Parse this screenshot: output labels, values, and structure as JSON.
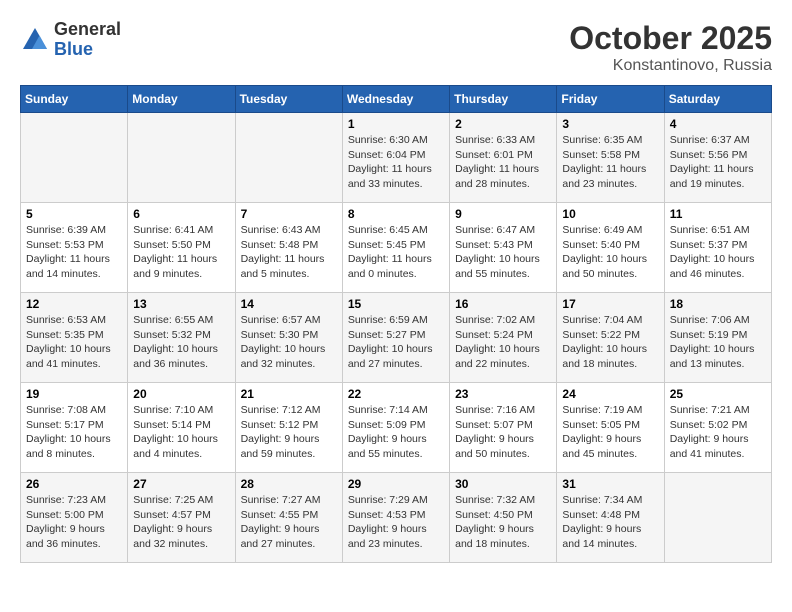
{
  "logo": {
    "general": "General",
    "blue": "Blue"
  },
  "header": {
    "month": "October 2025",
    "location": "Konstantinovo, Russia"
  },
  "days_header": [
    "Sunday",
    "Monday",
    "Tuesday",
    "Wednesday",
    "Thursday",
    "Friday",
    "Saturday"
  ],
  "weeks": [
    [
      {
        "day": "",
        "info": ""
      },
      {
        "day": "",
        "info": ""
      },
      {
        "day": "",
        "info": ""
      },
      {
        "day": "1",
        "info": "Sunrise: 6:30 AM\nSunset: 6:04 PM\nDaylight: 11 hours\nand 33 minutes."
      },
      {
        "day": "2",
        "info": "Sunrise: 6:33 AM\nSunset: 6:01 PM\nDaylight: 11 hours\nand 28 minutes."
      },
      {
        "day": "3",
        "info": "Sunrise: 6:35 AM\nSunset: 5:58 PM\nDaylight: 11 hours\nand 23 minutes."
      },
      {
        "day": "4",
        "info": "Sunrise: 6:37 AM\nSunset: 5:56 PM\nDaylight: 11 hours\nand 19 minutes."
      }
    ],
    [
      {
        "day": "5",
        "info": "Sunrise: 6:39 AM\nSunset: 5:53 PM\nDaylight: 11 hours\nand 14 minutes."
      },
      {
        "day": "6",
        "info": "Sunrise: 6:41 AM\nSunset: 5:50 PM\nDaylight: 11 hours\nand 9 minutes."
      },
      {
        "day": "7",
        "info": "Sunrise: 6:43 AM\nSunset: 5:48 PM\nDaylight: 11 hours\nand 5 minutes."
      },
      {
        "day": "8",
        "info": "Sunrise: 6:45 AM\nSunset: 5:45 PM\nDaylight: 11 hours\nand 0 minutes."
      },
      {
        "day": "9",
        "info": "Sunrise: 6:47 AM\nSunset: 5:43 PM\nDaylight: 10 hours\nand 55 minutes."
      },
      {
        "day": "10",
        "info": "Sunrise: 6:49 AM\nSunset: 5:40 PM\nDaylight: 10 hours\nand 50 minutes."
      },
      {
        "day": "11",
        "info": "Sunrise: 6:51 AM\nSunset: 5:37 PM\nDaylight: 10 hours\nand 46 minutes."
      }
    ],
    [
      {
        "day": "12",
        "info": "Sunrise: 6:53 AM\nSunset: 5:35 PM\nDaylight: 10 hours\nand 41 minutes."
      },
      {
        "day": "13",
        "info": "Sunrise: 6:55 AM\nSunset: 5:32 PM\nDaylight: 10 hours\nand 36 minutes."
      },
      {
        "day": "14",
        "info": "Sunrise: 6:57 AM\nSunset: 5:30 PM\nDaylight: 10 hours\nand 32 minutes."
      },
      {
        "day": "15",
        "info": "Sunrise: 6:59 AM\nSunset: 5:27 PM\nDaylight: 10 hours\nand 27 minutes."
      },
      {
        "day": "16",
        "info": "Sunrise: 7:02 AM\nSunset: 5:24 PM\nDaylight: 10 hours\nand 22 minutes."
      },
      {
        "day": "17",
        "info": "Sunrise: 7:04 AM\nSunset: 5:22 PM\nDaylight: 10 hours\nand 18 minutes."
      },
      {
        "day": "18",
        "info": "Sunrise: 7:06 AM\nSunset: 5:19 PM\nDaylight: 10 hours\nand 13 minutes."
      }
    ],
    [
      {
        "day": "19",
        "info": "Sunrise: 7:08 AM\nSunset: 5:17 PM\nDaylight: 10 hours\nand 8 minutes."
      },
      {
        "day": "20",
        "info": "Sunrise: 7:10 AM\nSunset: 5:14 PM\nDaylight: 10 hours\nand 4 minutes."
      },
      {
        "day": "21",
        "info": "Sunrise: 7:12 AM\nSunset: 5:12 PM\nDaylight: 9 hours\nand 59 minutes."
      },
      {
        "day": "22",
        "info": "Sunrise: 7:14 AM\nSunset: 5:09 PM\nDaylight: 9 hours\nand 55 minutes."
      },
      {
        "day": "23",
        "info": "Sunrise: 7:16 AM\nSunset: 5:07 PM\nDaylight: 9 hours\nand 50 minutes."
      },
      {
        "day": "24",
        "info": "Sunrise: 7:19 AM\nSunset: 5:05 PM\nDaylight: 9 hours\nand 45 minutes."
      },
      {
        "day": "25",
        "info": "Sunrise: 7:21 AM\nSunset: 5:02 PM\nDaylight: 9 hours\nand 41 minutes."
      }
    ],
    [
      {
        "day": "26",
        "info": "Sunrise: 7:23 AM\nSunset: 5:00 PM\nDaylight: 9 hours\nand 36 minutes."
      },
      {
        "day": "27",
        "info": "Sunrise: 7:25 AM\nSunset: 4:57 PM\nDaylight: 9 hours\nand 32 minutes."
      },
      {
        "day": "28",
        "info": "Sunrise: 7:27 AM\nSunset: 4:55 PM\nDaylight: 9 hours\nand 27 minutes."
      },
      {
        "day": "29",
        "info": "Sunrise: 7:29 AM\nSunset: 4:53 PM\nDaylight: 9 hours\nand 23 minutes."
      },
      {
        "day": "30",
        "info": "Sunrise: 7:32 AM\nSunset: 4:50 PM\nDaylight: 9 hours\nand 18 minutes."
      },
      {
        "day": "31",
        "info": "Sunrise: 7:34 AM\nSunset: 4:48 PM\nDaylight: 9 hours\nand 14 minutes."
      },
      {
        "day": "",
        "info": ""
      }
    ]
  ]
}
